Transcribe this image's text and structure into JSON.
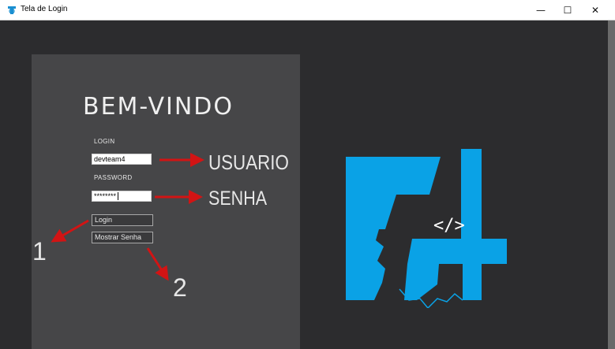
{
  "window": {
    "title": "Tela de Login",
    "controls": {
      "minimize": "—",
      "maximize": "☐",
      "close": "✕"
    }
  },
  "login_panel": {
    "welcome_heading": "BEM-VINDO",
    "login_label": "LOGIN",
    "login_value": "devteam4",
    "password_label": "PASSWORD",
    "password_value": "********",
    "login_button": "Login",
    "show_password_button": "Mostrar Senha"
  },
  "annotations": {
    "usuario": "USUARIO",
    "senha": "SENHA",
    "one": "1",
    "two": "2",
    "arrow_color": "#d21414"
  },
  "logo": {
    "brand_color": "#0aa2e6",
    "inner_text": "</>"
  }
}
